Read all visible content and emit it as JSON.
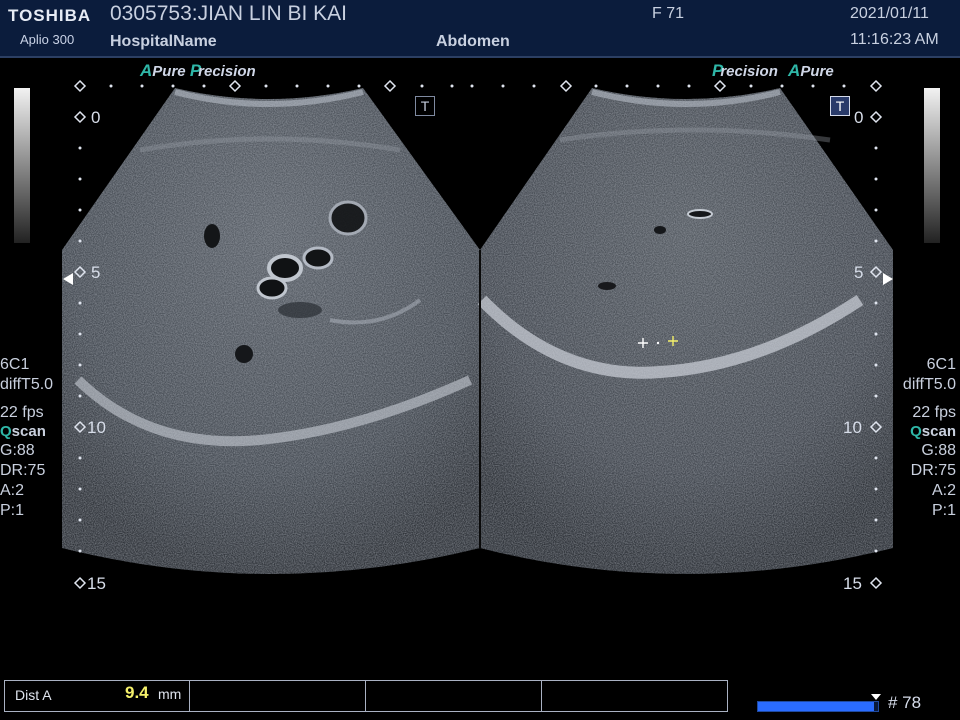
{
  "header": {
    "brand": "TOSHIBA",
    "model": "Aplio 300",
    "patient": "0305753:JIAN LIN BI KAI",
    "hospital": "HospitalName",
    "sex_age": "F  71",
    "exam": "Abdomen",
    "date": "2021/01/11",
    "time": "11:16:23 AM"
  },
  "left_logo": {
    "a1": "A",
    "w1": "Pure",
    "a2": "P",
    "w2": "recision"
  },
  "right_logo": {
    "a1": "P",
    "w1": "recision",
    "a2": "A",
    "w2": "Pure"
  },
  "depth_marks": [
    "0",
    "5",
    "10",
    "15"
  ],
  "trackball_icon": "T",
  "left_params": {
    "transducer": "6C1",
    "mode": "diffT5.0",
    "fps": "22 fps",
    "qscan_q": "Q",
    "qscan_rest": "scan",
    "gain": "G:88",
    "dr": "DR:75",
    "a": "A:2",
    "p": "P:1"
  },
  "right_params": {
    "transducer": "6C1",
    "mode": "diffT5.0",
    "fps": "22 fps",
    "qscan_q": "Q",
    "qscan_rest": "scan",
    "gain": "G:88",
    "dr": "DR:75",
    "a": "A:2",
    "p": "P:1"
  },
  "measurement": {
    "label": "Dist A",
    "value": "9.4",
    "unit": "mm"
  },
  "cine": {
    "frame": "# 78",
    "progress": 0.97
  },
  "colors": {
    "header_bg": "#0b1c3c",
    "accent": "#2fb7a8",
    "measure_value": "#f4f06a",
    "progress": "#2a6cff"
  }
}
